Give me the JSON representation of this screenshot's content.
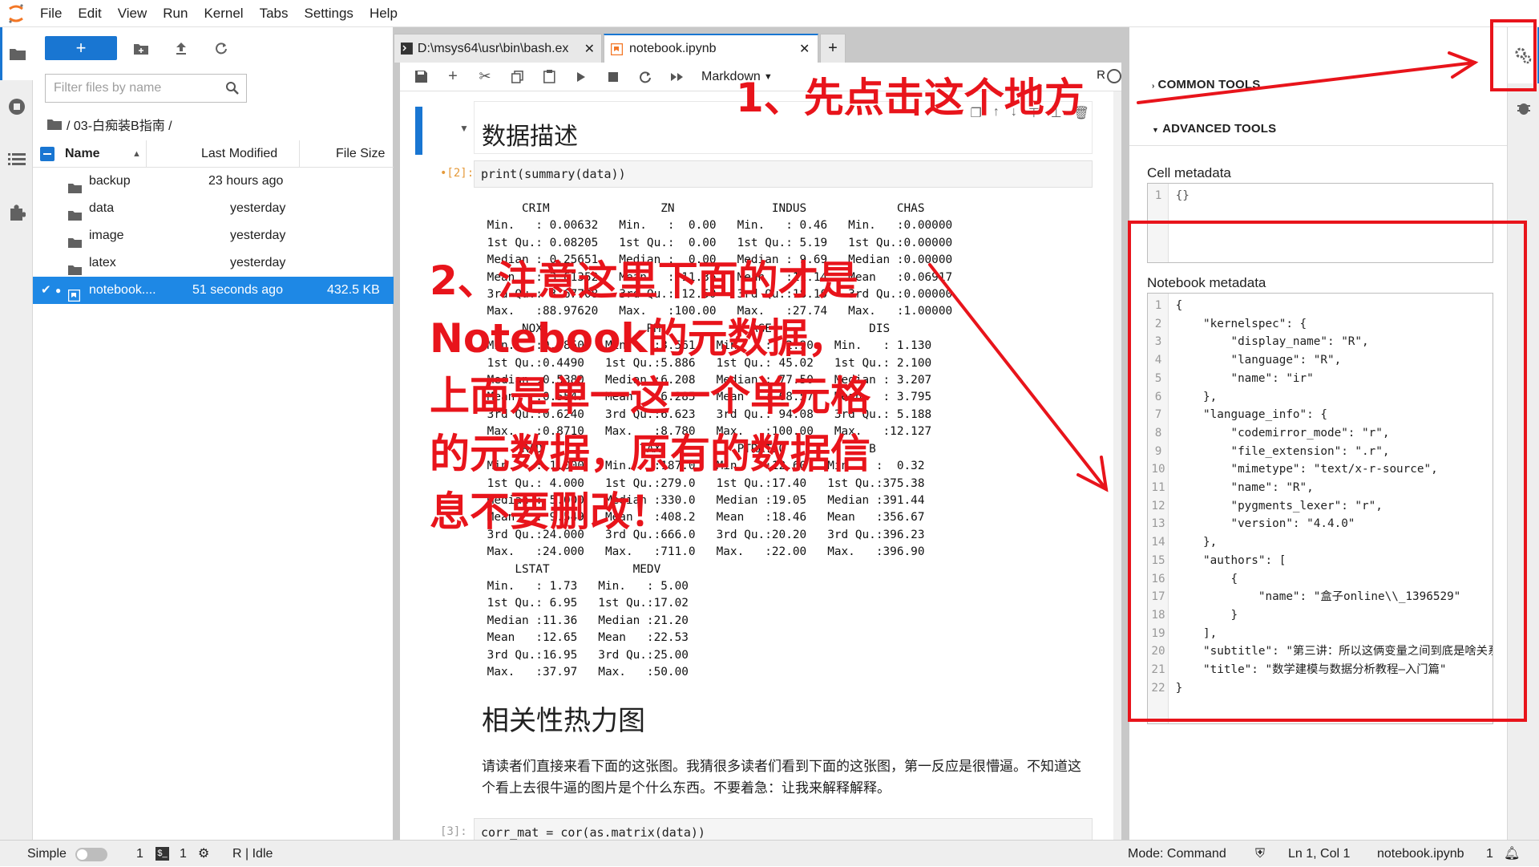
{
  "menubar": {
    "items": [
      "File",
      "Edit",
      "View",
      "Run",
      "Kernel",
      "Tabs",
      "Settings",
      "Help"
    ]
  },
  "filebrowser": {
    "new_label": "+",
    "filter_placeholder": "Filter files by name",
    "breadcrumb": "/ 03-白痴装B指南 /",
    "columns": {
      "name": "Name",
      "modified": "Last Modified",
      "size": "File Size"
    },
    "rows": [
      {
        "name": "backup",
        "modified": "23 hours ago",
        "size": "",
        "type": "folder"
      },
      {
        "name": "data",
        "modified": "yesterday",
        "size": "",
        "type": "folder"
      },
      {
        "name": "image",
        "modified": "yesterday",
        "size": "",
        "type": "folder"
      },
      {
        "name": "latex",
        "modified": "yesterday",
        "size": "",
        "type": "folder"
      },
      {
        "name": "notebook....",
        "modified": "51 seconds ago",
        "size": "432.5 KB",
        "type": "notebook"
      }
    ]
  },
  "tabs": [
    {
      "label": "D:\\msys64\\usr\\bin\\bash.ex",
      "active": false
    },
    {
      "label": "notebook.ipynb",
      "active": true
    }
  ],
  "notebook": {
    "cell_type": "Markdown",
    "kernel": "R",
    "heading1": "数据描述",
    "cell2_prompt": "•[2]:",
    "cell2_code": "print(summary(data))",
    "cell2_output": "      CRIM                ZN              INDUS             CHAS        \n Min.   : 0.00632   Min.   :  0.00   Min.   : 0.46   Min.   :0.00000  \n 1st Qu.: 0.08205   1st Qu.:  0.00   1st Qu.: 5.19   1st Qu.:0.00000  \n Median : 0.25651   Median :  0.00   Median : 9.69   Median :0.00000  \n Mean   : 3.61352   Mean   : 11.36   Mean   :11.14   Mean   :0.06917  \n 3rd Qu.: 3.67708   3rd Qu.: 12.50   3rd Qu.:18.10   3rd Qu.:0.00000  \n Max.   :88.97620   Max.   :100.00   Max.   :27.74   Max.   :1.00000  \n      NOX               RM             AGE              DIS        \n Min.   :0.3850   Min.   :3.561   Min.   :  2.90   Min.   : 1.130  \n 1st Qu.:0.4490   1st Qu.:5.886   1st Qu.: 45.02   1st Qu.: 2.100  \n Median :0.5380   Median :6.208   Median : 77.50   Median : 3.207  \n Mean   :0.5547   Mean   :6.285   Mean   : 68.57   Mean   : 3.795  \n 3rd Qu.:0.6240   3rd Qu.:6.623   3rd Qu.: 94.08   3rd Qu.: 5.188  \n Max.   :0.8710   Max.   :8.780   Max.   :100.00   Max.   :12.127  \n      RAD              TAX           PTRATIO            B        \n Min.   : 1.000   Min.   :187.0   Min.   :12.60   Min.   :  0.32  \n 1st Qu.: 4.000   1st Qu.:279.0   1st Qu.:17.40   1st Qu.:375.38  \n Median : 5.000   Median :330.0   Median :19.05   Median :391.44  \n Mean   : 9.549   Mean   :408.2   Mean   :18.46   Mean   :356.67  \n 3rd Qu.:24.000   3rd Qu.:666.0   3rd Qu.:20.20   3rd Qu.:396.23  \n Max.   :24.000   Max.   :711.0   Max.   :22.00   Max.   :396.90  \n     LSTAT            MEDV      \n Min.   : 1.73   Min.   : 5.00  \n 1st Qu.: 6.95   1st Qu.:17.02  \n Median :11.36   Median :21.20  \n Mean   :12.65   Mean   :22.53  \n 3rd Qu.:16.95   3rd Qu.:25.00  \n Max.   :37.97   Max.   :50.00  ",
    "heading2": "相关性热力图",
    "paragraph": "请读者们直接来看下面的这张图。我猜很多读者们看到下面的这张图，第一反应是很懵逼。不知道这个看上去很牛逼的图片是个什么东西。不要着急：让我来解释解释。",
    "cell3_prompt": "[3]:",
    "cell3_code": "corr_mat = cor(as.matrix(data))"
  },
  "inspector": {
    "common_tools": "COMMON TOOLS",
    "advanced_tools": "ADVANCED TOOLS",
    "cell_metadata_label": "Cell metadata",
    "cell_metadata": "{}",
    "notebook_metadata_label": "Notebook metadata",
    "notebook_metadata_lines": [
      "{",
      "    \"kernelspec\": {",
      "        \"display_name\": \"R\",",
      "        \"language\": \"R\",",
      "        \"name\": \"ir\"",
      "    },",
      "    \"language_info\": {",
      "        \"codemirror_mode\": \"r\",",
      "        \"file_extension\": \".r\",",
      "        \"mimetype\": \"text/x-r-source\",",
      "        \"name\": \"R\",",
      "        \"pygments_lexer\": \"r\",",
      "        \"version\": \"4.4.0\"",
      "    },",
      "    \"authors\": [",
      "        {",
      "            \"name\": \"盒子online\\\\_1396529\"",
      "        }",
      "    ],",
      "    \"subtitle\": \"第三讲：所以这俩变量之间到底是啥关系\",",
      "    \"title\": \"数学建模与数据分析教程—入门篇\"",
      "}"
    ]
  },
  "statusbar": {
    "simple_label": "Simple",
    "terminals": "1",
    "kernels": "1",
    "kernel_status": "R | Idle",
    "mode": "Mode: Command",
    "position": "Ln 1, Col 1",
    "filename": "notebook.ipynb",
    "notifications": "1"
  },
  "annotations": {
    "note1": "1、先点击这个地方",
    "note2": "2、注意这里下面的才是Notebook的元数据，上面是单一这一个单元格的元数据，原有的数据信息不要删改！",
    "color": "#e8141b"
  },
  "colors": {
    "accent": "#1976d2",
    "selected_row": "#1e88e5"
  }
}
